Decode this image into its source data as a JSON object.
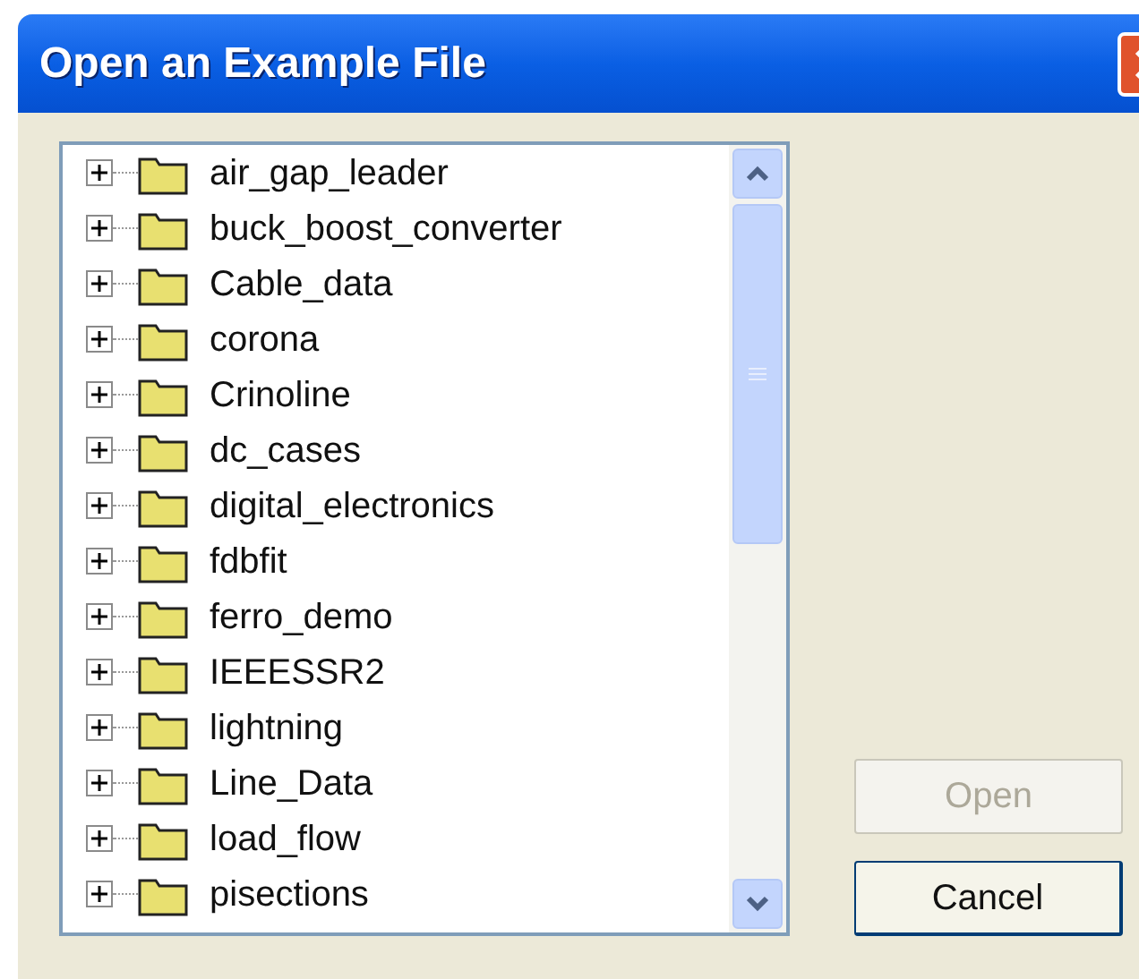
{
  "window": {
    "title": "Open an Example File"
  },
  "tree": {
    "items": [
      {
        "label": "air_gap_leader",
        "expanded": false
      },
      {
        "label": "buck_boost_converter",
        "expanded": false
      },
      {
        "label": "Cable_data",
        "expanded": false
      },
      {
        "label": "corona",
        "expanded": false
      },
      {
        "label": "Crinoline",
        "expanded": false
      },
      {
        "label": "dc_cases",
        "expanded": false
      },
      {
        "label": "digital_electronics",
        "expanded": false
      },
      {
        "label": "fdbfit",
        "expanded": false
      },
      {
        "label": "ferro_demo",
        "expanded": false
      },
      {
        "label": "IEEESSR2",
        "expanded": false
      },
      {
        "label": "lightning",
        "expanded": false
      },
      {
        "label": "Line_Data",
        "expanded": false
      },
      {
        "label": "load_flow",
        "expanded": false
      },
      {
        "label": "pisections",
        "expanded": false
      }
    ]
  },
  "buttons": [
    {
      "label": "Open",
      "disabled": true
    },
    {
      "label": "Cancel",
      "disabled": false
    }
  ]
}
